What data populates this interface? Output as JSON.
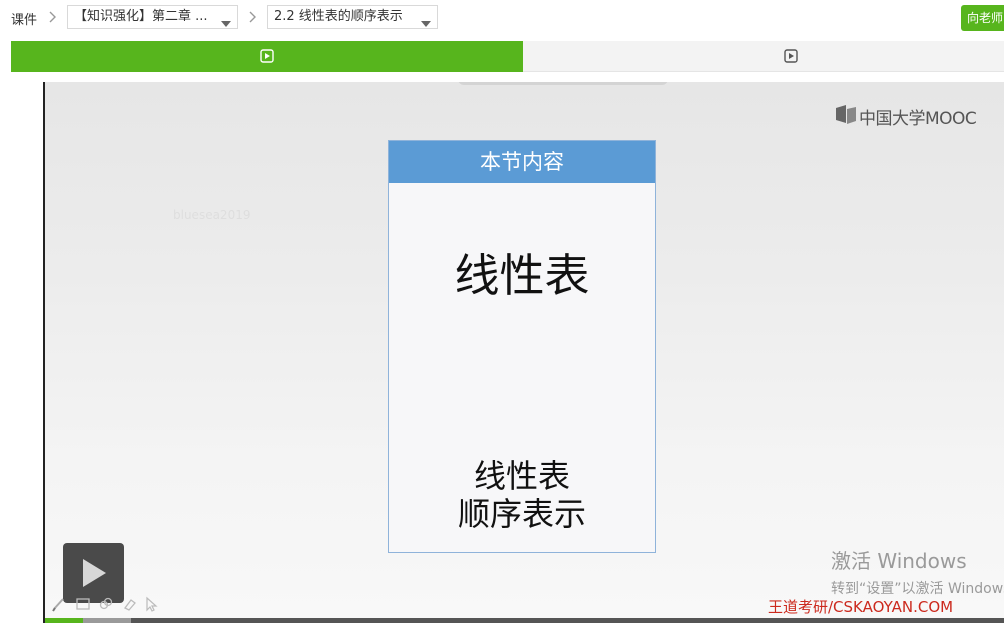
{
  "breadcrumb": {
    "root": "课件",
    "chapter": "【知识强化】第二章 ...",
    "section": "2.2 线性表的顺序表示"
  },
  "header": {
    "teacher_button": "向老师"
  },
  "video": {
    "brand": "中国大学MOOC",
    "user_watermark": "bluesea2019",
    "slide": {
      "header": "本节内容",
      "item1": "线性表",
      "item2_line1": "线性表",
      "item2_line2": "顺序表示"
    },
    "activation": {
      "title": "激活 Windows",
      "subtitle": "转到“设置”以激活 Windows"
    },
    "site_mark": "王道考研/CSKAOYAN.COM",
    "progress": 0.04,
    "buffered": 0.09
  },
  "icons": {
    "tab1": "video-play-icon",
    "tab2": "video-play-icon",
    "play": "play-icon",
    "tools": [
      "pencil-icon",
      "image-icon",
      "link-icon",
      "eraser-icon",
      "pointer-icon"
    ]
  },
  "colors": {
    "accent": "#57b51d",
    "slide_header": "#5b9bd5",
    "site_mark": "#cc2a1e"
  }
}
